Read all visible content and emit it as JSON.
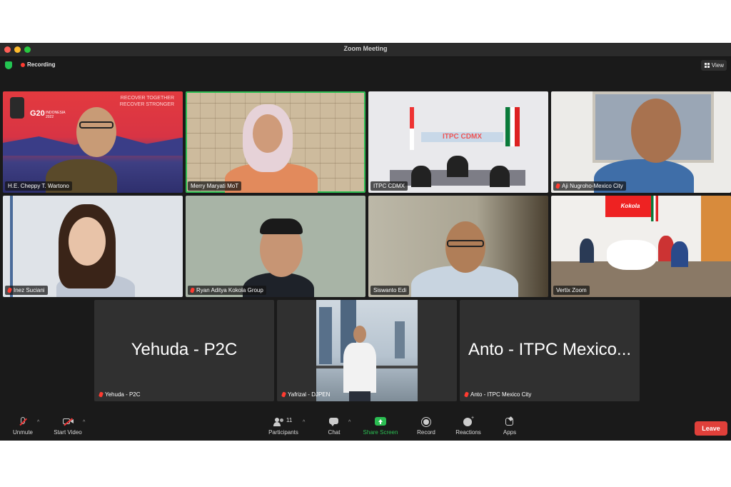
{
  "window": {
    "title": "Zoom Meeting"
  },
  "topbar": {
    "recording_label": "Recording",
    "view_label": "View"
  },
  "banner": {
    "line1": "RECOVER TOGETHER",
    "line2": "RECOVER STRONGER",
    "g20": "G20",
    "year": "INDONESIA 2022"
  },
  "participants": [
    {
      "name": "H.E. Cheppy T. Wartono",
      "muted": false
    },
    {
      "name": "Merry Maryati MoT",
      "muted": false,
      "active_speaker": true
    },
    {
      "name": "ITPC CDMX",
      "muted": false,
      "sign_text": "ITPC CDMX"
    },
    {
      "name": "Aji Nugroho-Mexico City",
      "muted": true
    },
    {
      "name": "Inez Suciani",
      "muted": true
    },
    {
      "name": "Ryan Aditya Kokola Group",
      "muted": true
    },
    {
      "name": "Siswanto Edi",
      "muted": false
    },
    {
      "name": "Vertix Zoom",
      "muted": false,
      "banner_text": "Kokola"
    },
    {
      "name": "Yehuda - P2C",
      "muted": true,
      "display_name": "Yehuda - P2C"
    },
    {
      "name": "Yafrizal - DJPEN",
      "muted": true
    },
    {
      "name": "Anto - ITPC Mexico City",
      "muted": true,
      "display_name": "Anto - ITPC Mexico..."
    }
  ],
  "toolbar": {
    "unmute": "Unmute",
    "start_video": "Start Video",
    "participants": "Participants",
    "participants_count": "11",
    "chat": "Chat",
    "share_screen": "Share Screen",
    "record": "Record",
    "reactions": "Reactions",
    "apps": "Apps",
    "leave": "Leave"
  },
  "colors": {
    "share_green": "#2bbd52",
    "leave_red": "#e0403a",
    "active_border": "#2bbd52"
  }
}
